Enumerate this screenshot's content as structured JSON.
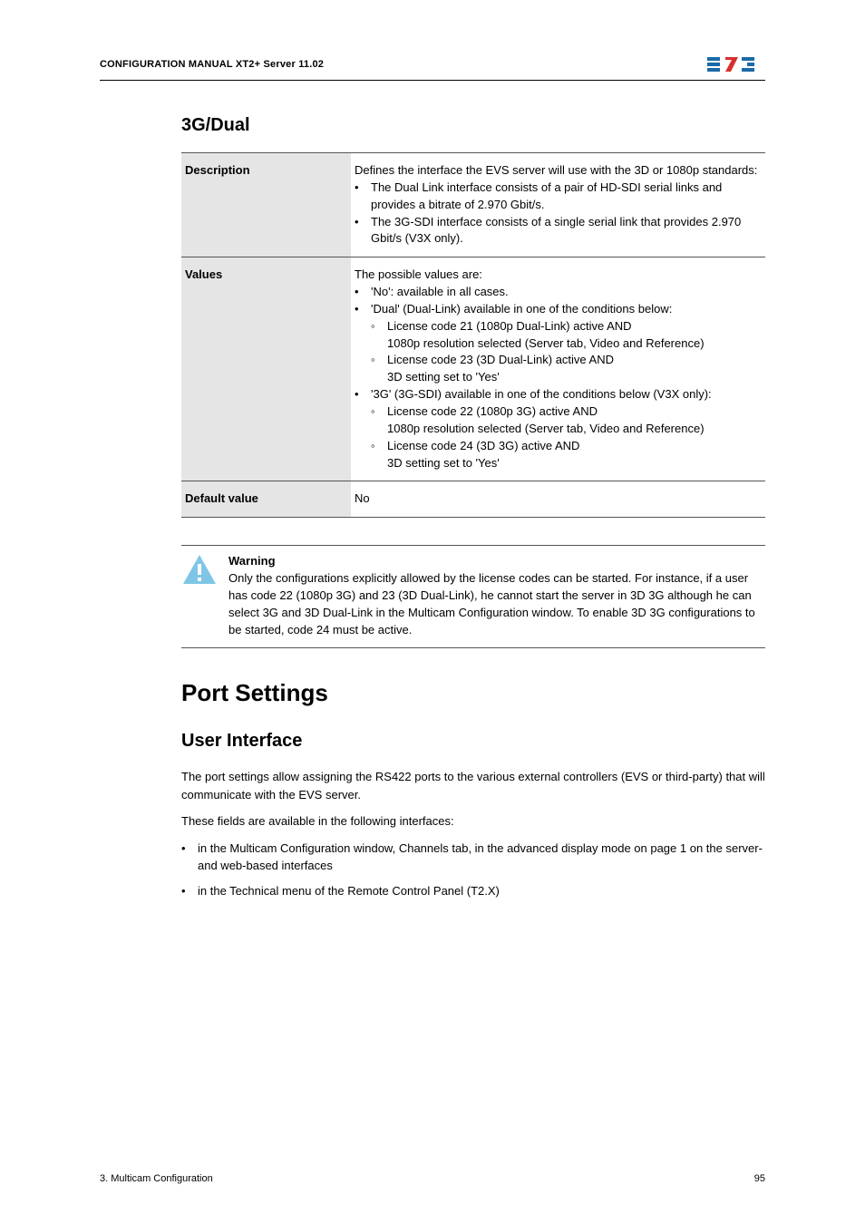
{
  "header": {
    "title": "CONFIGURATION MANUAL  XT2+ Server 11.02"
  },
  "logo": {
    "name": "evs-logo"
  },
  "section1": {
    "heading": "3G/Dual"
  },
  "table": {
    "rows": [
      {
        "label": "Description",
        "desc_intro": "Defines the interface the EVS server will use with the 3D or 1080p standards:",
        "desc_items": [
          "The Dual Link interface consists of a pair of HD-SDI serial links and provides a bitrate of 2.970 Gbit/s.",
          "The 3G-SDI interface consists of a single serial link that provides 2.970 Gbit/s (V3X only)."
        ]
      },
      {
        "label": "Values",
        "val_intro": "The possible values are:",
        "val_items": {
          "a": "'No': available in all cases.",
          "b": "'Dual' (Dual-Link) available in one of the conditions below:",
          "b_sub": [
            {
              "line1": "License code 21 (1080p Dual-Link) active AND",
              "line2": "1080p resolution selected (Server tab, Video and Reference)"
            },
            {
              "line1": "License code 23 (3D Dual-Link) active AND",
              "line2": "3D setting set to 'Yes'"
            }
          ],
          "c": "'3G' (3G-SDI) available in one of the conditions below (V3X only):",
          "c_sub": [
            {
              "line1": "License code 22 (1080p 3G) active AND",
              "line2": "1080p resolution selected (Server tab, Video and Reference)"
            },
            {
              "line1": "License code 24 (3D 3G) active AND",
              "line2": "3D setting set to 'Yes'"
            }
          ]
        }
      },
      {
        "label": "Default value",
        "default_value": "No"
      }
    ]
  },
  "warning": {
    "title": "Warning",
    "body": "Only the configurations explicitly allowed by the license codes can be started. For instance, if a user has code 22 (1080p 3G) and 23 (3D Dual-Link), he cannot start the server in 3D 3G although he can select 3G and 3D Dual-Link in the Multicam Configuration window. To enable 3D 3G configurations to be started, code 24 must be active."
  },
  "section2": {
    "heading": "Port Settings",
    "subheading": "User Interface",
    "p1": "The port settings allow assigning the RS422 ports to the various external controllers (EVS or third-party) that will communicate with the EVS server.",
    "p2": "These fields are available in the following interfaces:",
    "items": [
      "in the Multicam Configuration window, Channels tab, in the advanced display mode on page 1 on the server- and web-based interfaces",
      "in the Technical menu of the Remote Control Panel (T2.X)"
    ]
  },
  "footer": {
    "left": "3. Multicam Configuration",
    "right": "95"
  }
}
